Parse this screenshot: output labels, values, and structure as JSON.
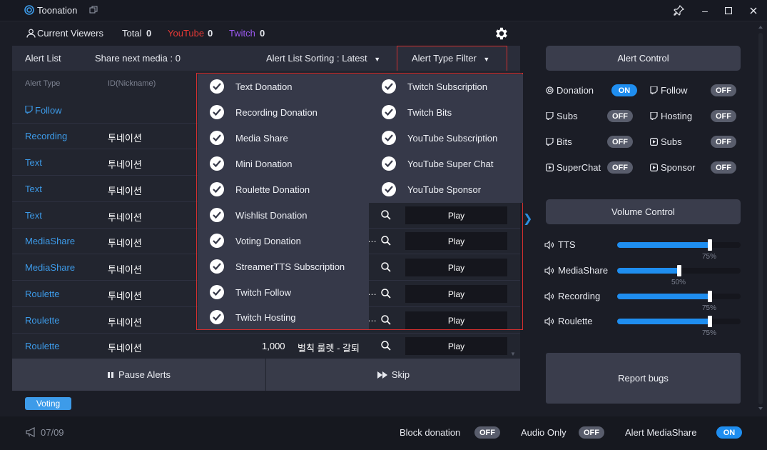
{
  "window": {
    "title": "Toonation"
  },
  "viewers": {
    "label": "Current Viewers",
    "total_label": "Total",
    "total": "0",
    "youtube_label": "YouTube",
    "youtube": "0",
    "twitch_label": "Twitch",
    "twitch": "0"
  },
  "alert_header": {
    "title": "Alert List",
    "share_next": "Share next media : 0",
    "sorting": "Alert List Sorting : Latest",
    "filter": "Alert Type Filter"
  },
  "table": {
    "columns": [
      "Alert Type",
      "ID(Nickname)"
    ],
    "rows": [
      {
        "type": "Follow",
        "id": "",
        "amount": "",
        "message": ""
      },
      {
        "type": "Recording",
        "id": "투네이션",
        "amount": "",
        "message": ""
      },
      {
        "type": "Text",
        "id": "투네이션",
        "amount": "",
        "message": ""
      },
      {
        "type": "Text",
        "id": "투네이션",
        "amount": "",
        "message": ""
      },
      {
        "type": "Text",
        "id": "투네이션",
        "amount": "",
        "message": "",
        "play": "Play"
      },
      {
        "type": "MediaShare",
        "id": "투네이션",
        "amount": "",
        "message": "",
        "play": "Play"
      },
      {
        "type": "MediaShare",
        "id": "투네이션",
        "amount": "",
        "message": "",
        "play": "Play"
      },
      {
        "type": "Roulette",
        "id": "투네이션",
        "amount": "",
        "message": "",
        "play": "Play"
      },
      {
        "type": "Roulette",
        "id": "투네이션",
        "amount": "",
        "message": "",
        "play": "Play"
      },
      {
        "type": "Roulette",
        "id": "투네이션",
        "amount": "1,000",
        "message": "벌칙 룰렛 - 갈퇴",
        "play": "Play"
      }
    ]
  },
  "filter_dropdown": {
    "left_items": [
      "Text Donation",
      "Recording Donation",
      "Media Share",
      "Mini Donation",
      "Roulette Donation",
      "Wishlist Donation",
      "Voting Donation",
      "StreamerTTS Subscription",
      "Twitch Follow",
      "Twitch Hosting"
    ],
    "right_items": [
      "Twitch Subscription",
      "Twitch Bits",
      "YouTube Subscription",
      "YouTube Super Chat",
      "YouTube Sponsor"
    ]
  },
  "controls": {
    "pause": "Pause Alerts",
    "skip": "Skip"
  },
  "voting_badge": "Voting",
  "alert_control": {
    "title": "Alert Control",
    "toggles": [
      {
        "label": "Donation",
        "state": "ON",
        "icon": "donation-icon"
      },
      {
        "label": "Follow",
        "state": "OFF",
        "icon": "twitch-icon"
      },
      {
        "label": "Subs",
        "state": "OFF",
        "icon": "twitch-icon"
      },
      {
        "label": "Hosting",
        "state": "OFF",
        "icon": "twitch-icon"
      },
      {
        "label": "Bits",
        "state": "OFF",
        "icon": "twitch-icon"
      },
      {
        "label": "Subs",
        "state": "OFF",
        "icon": "youtube-icon"
      },
      {
        "label": "SuperChat",
        "state": "OFF",
        "icon": "youtube-icon"
      },
      {
        "label": "Sponsor",
        "state": "OFF",
        "icon": "youtube-icon"
      }
    ]
  },
  "volume_control": {
    "title": "Volume Control",
    "channels": [
      {
        "label": "TTS",
        "value": 75,
        "pct": "75%"
      },
      {
        "label": "MediaShare",
        "value": 50,
        "pct": "50%"
      },
      {
        "label": "Recording",
        "value": 75,
        "pct": "75%"
      },
      {
        "label": "Roulette",
        "value": 75,
        "pct": "75%"
      }
    ]
  },
  "report_bugs": "Report bugs",
  "footer": {
    "page": "07/09",
    "block_donation": "Block donation",
    "block_donation_state": "OFF",
    "audio_only": "Audio Only",
    "audio_only_state": "OFF",
    "alert_mediashare": "Alert MediaShare",
    "alert_mediashare_state": "ON"
  },
  "colors": {
    "accent": "#1f8ef0",
    "link": "#3d9be9",
    "youtube": "#e53935",
    "twitch": "#9b59f0",
    "highlight_border": "#d32f2f"
  }
}
